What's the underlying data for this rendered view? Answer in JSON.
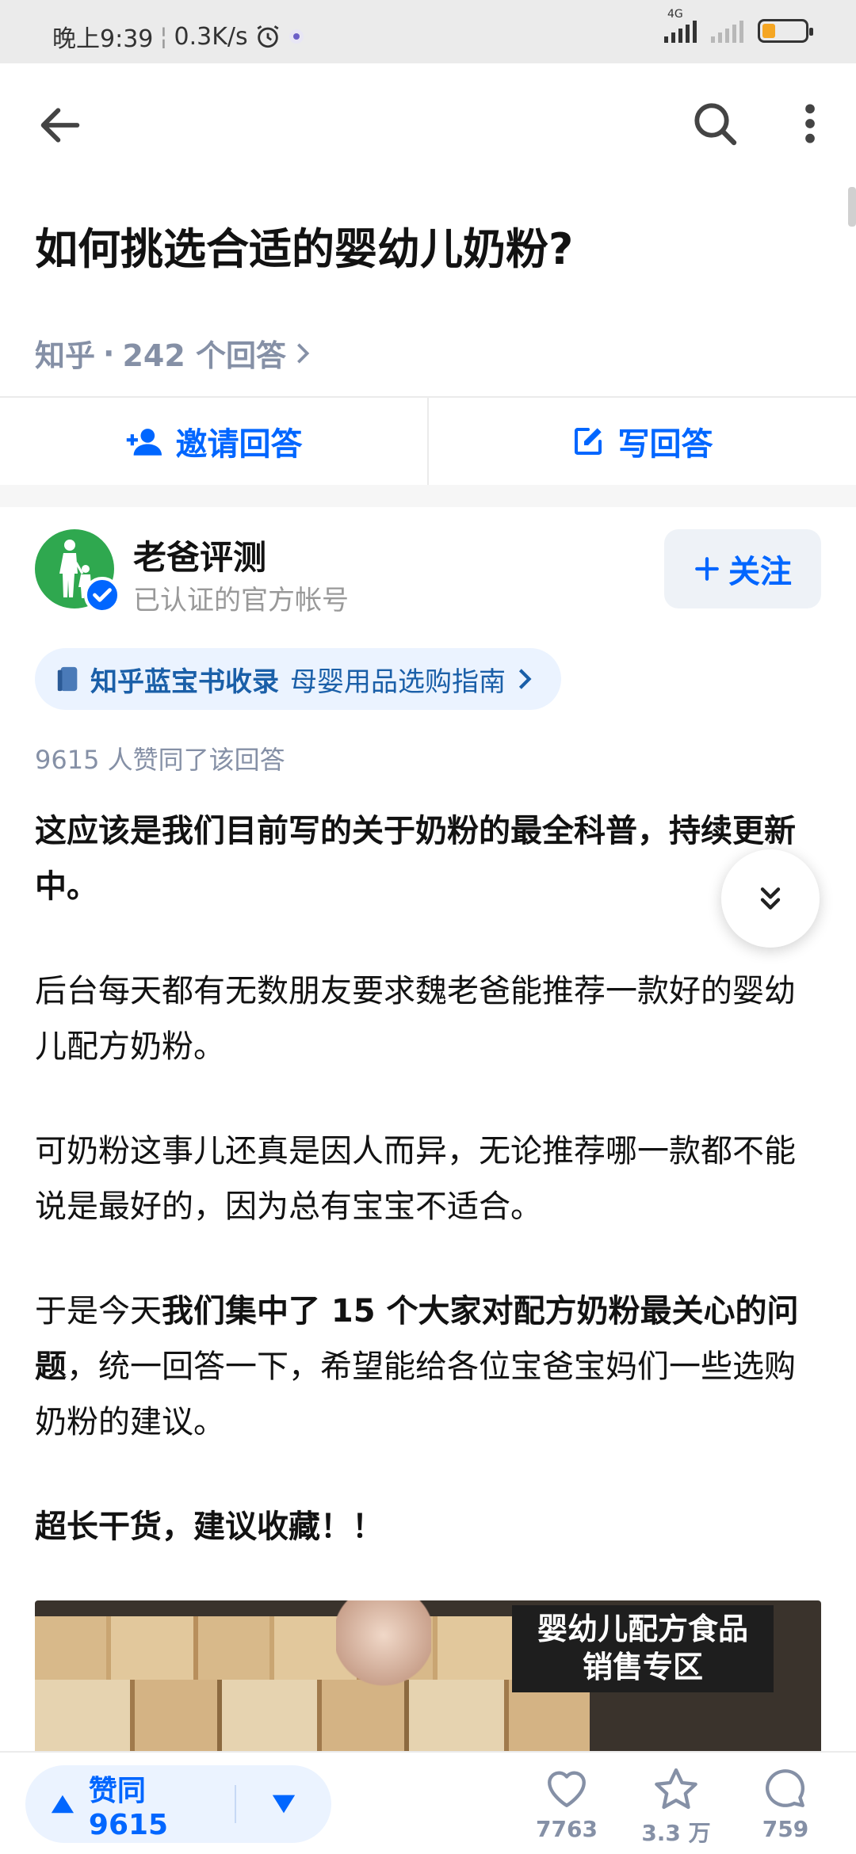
{
  "status_bar": {
    "time": "晚上9:39",
    "net_speed": "0.3K/s",
    "network_type": "4G",
    "battery_level": 0.3,
    "colors": {
      "battery_fill": "#f5a623"
    }
  },
  "header": {
    "icons": [
      "arrow-left-icon",
      "search-icon",
      "more-vertical-icon"
    ]
  },
  "question": {
    "title": "如何挑选合适的婴幼儿奶粉?",
    "source": "知乎",
    "separator": "·",
    "answer_count": "242 个回答"
  },
  "actions": {
    "invite_label": "邀请回答",
    "write_label": "写回答"
  },
  "author": {
    "name": "老爸评测",
    "description": "已认证的官方帐号",
    "follow_label": "关注",
    "avatar_color": "#2fa84f"
  },
  "bluebook": {
    "brand": "知乎蓝宝书收录",
    "title": "母婴用品选购指南"
  },
  "answer": {
    "votes_text": "9615 人赞同了该回答",
    "p1": "这应该是我们目前写的关于奶粉的最全科普，持续更新中。",
    "p2": "后台每天都有无数朋友要求魏老爸能推荐一款好的婴幼儿配方奶粉。",
    "p3": "可奶粉这事儿还真是因人而异，无论推荐哪一款都不能说是最好的，因为总有宝宝不适合。",
    "p4_a": "于是今天",
    "p4_b": "我们集中了 15 个大家对配方奶粉最关心的问题",
    "p4_c": "，统一回答一下，希望能给各位宝爸宝妈们一些选购奶粉的建议。",
    "p5": "超长干货，建议收藏！！",
    "image_sign_line1": "婴幼儿配方食品",
    "image_sign_line2": "销售专区"
  },
  "bottom_bar": {
    "vote_label": "赞同 9615",
    "likes": "7763",
    "favorites": "3.3 万",
    "comments": "759"
  },
  "colors": {
    "accent": "#0066ff",
    "meta_gray": "#8590a6",
    "text": "#121212"
  }
}
